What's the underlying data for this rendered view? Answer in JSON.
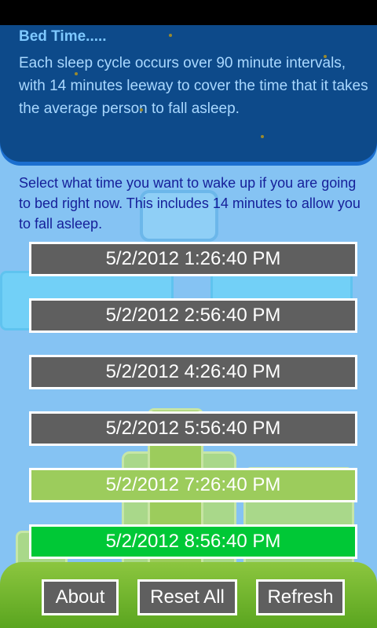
{
  "info": {
    "title": "Bed Time.....",
    "text": "Each sleep cycle occurs over 90 minute intervals, with 14 minutes leeway to cover the time that it takes the average person to fall asleep."
  },
  "prompt": "Select what time you want to wake up if you are going to bed right now. This includes 14 minutes to allow you to fall asleep.",
  "times": [
    {
      "label": "5/2/2012 1:26:40 PM",
      "color": "#5f5f5f"
    },
    {
      "label": "5/2/2012 2:56:40 PM",
      "color": "#5f5f5f"
    },
    {
      "label": "5/2/2012 4:26:40 PM",
      "color": "#5f5f5f"
    },
    {
      "label": "5/2/2012 5:56:40 PM",
      "color": "#5f5f5f"
    },
    {
      "label": "5/2/2012 7:26:40 PM",
      "color": "#9ccc5c"
    },
    {
      "label": "5/2/2012 8:56:40 PM",
      "color": "#00c836"
    }
  ],
  "buttons": {
    "about": "About",
    "reset": "Reset All",
    "refresh": "Refresh"
  },
  "colors": {
    "panel": "#0d4a8a",
    "background": "#85c3f3",
    "bottom_bar": "#7bbd33"
  }
}
